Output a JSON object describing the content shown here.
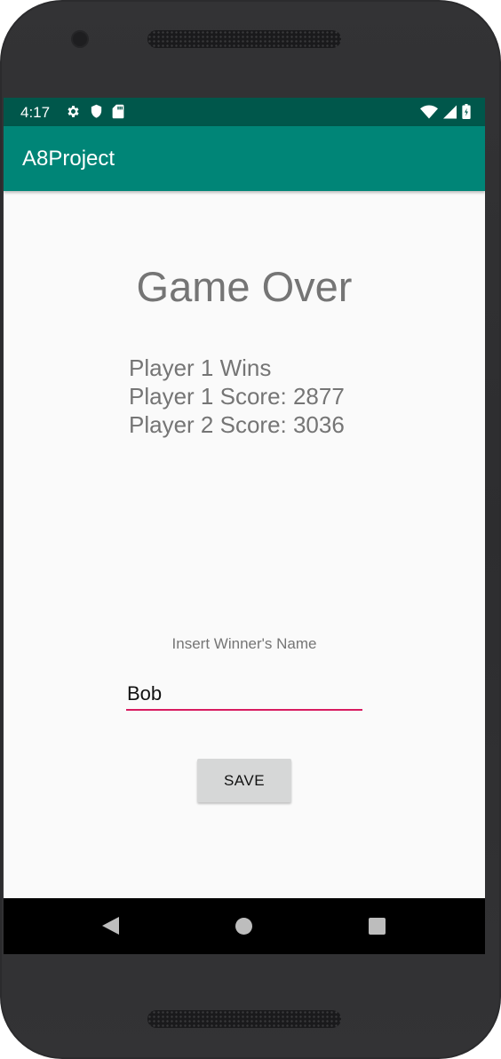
{
  "status_bar": {
    "time": "4:17",
    "left_icons": [
      "gear-icon",
      "shield-icon",
      "sd-card-icon"
    ],
    "right_icons": [
      "wifi-icon",
      "signal-icon",
      "battery-icon"
    ],
    "background_color": "#00574b"
  },
  "app_bar": {
    "title": "A8Project",
    "background_color": "#008577"
  },
  "main": {
    "heading": "Game Over",
    "results": {
      "winner_line": "Player 1 Wins",
      "player1_score_line": "Player 1 Score: 2877",
      "player2_score_line": "Player 2 Score: 3036"
    },
    "name_label": "Insert Winner's Name",
    "name_input_value": "Bob",
    "name_input_underline_color": "#d81b60",
    "save_button_label": "SAVE"
  },
  "nav_bar": {
    "buttons": [
      "back-icon",
      "home-icon",
      "recents-icon"
    ]
  }
}
